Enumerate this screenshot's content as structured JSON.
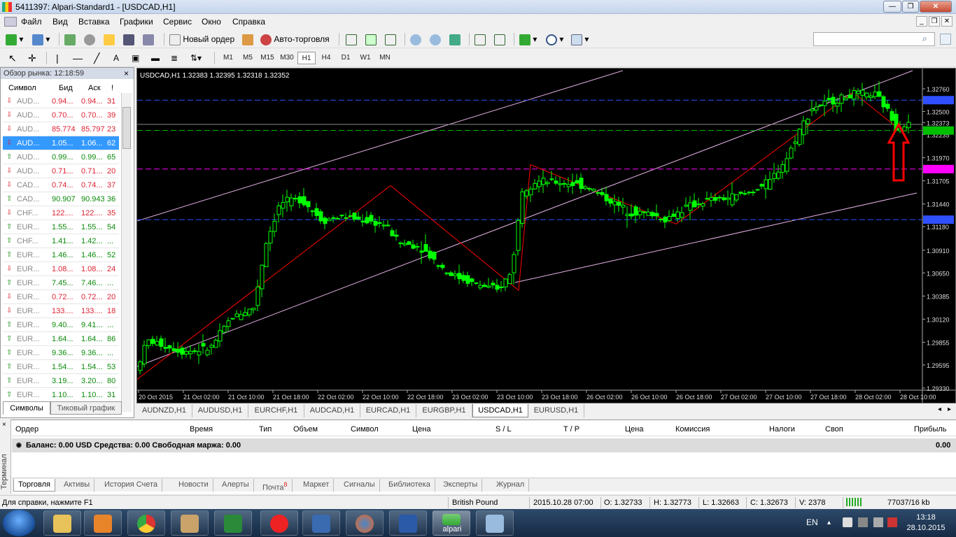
{
  "window": {
    "title": "5411397: Alpari-Standard1 - [USDCAD,H1]"
  },
  "menu": [
    "Файл",
    "Вид",
    "Вставка",
    "Графики",
    "Сервис",
    "Окно",
    "Справка"
  ],
  "toolbar": {
    "new_order": "Новый ордер",
    "auto_trading": "Авто-торговля"
  },
  "timeframes": [
    "M1",
    "M5",
    "M15",
    "M30",
    "H1",
    "H4",
    "D1",
    "W1",
    "MN"
  ],
  "selected_timeframe": "H1",
  "market_watch": {
    "title": "Обзор рынка: 12:18:59",
    "columns": [
      "Символ",
      "Бид",
      "Аск",
      "!"
    ],
    "rows": [
      {
        "symbol": "AUD...",
        "bid": "0.94...",
        "ask": "0.94...",
        "spread": "31",
        "dir": "down"
      },
      {
        "symbol": "AUD...",
        "bid": "0.70...",
        "ask": "0.70...",
        "spread": "39",
        "dir": "down"
      },
      {
        "symbol": "AUD...",
        "bid": "85.774",
        "ask": "85.797",
        "spread": "23",
        "dir": "down"
      },
      {
        "symbol": "AUD...",
        "bid": "1.05...",
        "ask": "1.06...",
        "spread": "62",
        "dir": "down",
        "selected": true
      },
      {
        "symbol": "AUD...",
        "bid": "0.99...",
        "ask": "0.99...",
        "spread": "65",
        "dir": "up"
      },
      {
        "symbol": "AUD...",
        "bid": "0.71...",
        "ask": "0.71...",
        "spread": "20",
        "dir": "down"
      },
      {
        "symbol": "CAD...",
        "bid": "0.74...",
        "ask": "0.74...",
        "spread": "37",
        "dir": "down"
      },
      {
        "symbol": "CAD...",
        "bid": "90.907",
        "ask": "90.943",
        "spread": "36",
        "dir": "up"
      },
      {
        "symbol": "CHF...",
        "bid": "122....",
        "ask": "122....",
        "spread": "35",
        "dir": "down"
      },
      {
        "symbol": "EUR...",
        "bid": "1.55...",
        "ask": "1.55...",
        "spread": "54",
        "dir": "up"
      },
      {
        "symbol": "CHF...",
        "bid": "1.41...",
        "ask": "1.42...",
        "spread": "...",
        "dir": "up"
      },
      {
        "symbol": "EUR...",
        "bid": "1.46...",
        "ask": "1.46...",
        "spread": "52",
        "dir": "up"
      },
      {
        "symbol": "EUR...",
        "bid": "1.08...",
        "ask": "1.08...",
        "spread": "24",
        "dir": "down"
      },
      {
        "symbol": "EUR...",
        "bid": "7.45...",
        "ask": "7.46...",
        "spread": "...",
        "dir": "up"
      },
      {
        "symbol": "EUR...",
        "bid": "0.72...",
        "ask": "0.72...",
        "spread": "20",
        "dir": "down"
      },
      {
        "symbol": "EUR...",
        "bid": "133....",
        "ask": "133....",
        "spread": "18",
        "dir": "down"
      },
      {
        "symbol": "EUR...",
        "bid": "9.40...",
        "ask": "9.41...",
        "spread": "...",
        "dir": "up"
      },
      {
        "symbol": "EUR...",
        "bid": "1.64...",
        "ask": "1.64...",
        "spread": "86",
        "dir": "up"
      },
      {
        "symbol": "EUR...",
        "bid": "9.36...",
        "ask": "9.36...",
        "spread": "...",
        "dir": "up"
      },
      {
        "symbol": "EUR...",
        "bid": "1.54...",
        "ask": "1.54...",
        "spread": "53",
        "dir": "up"
      },
      {
        "symbol": "EUR...",
        "bid": "3.19...",
        "ask": "3.20...",
        "spread": "80",
        "dir": "up"
      },
      {
        "symbol": "EUR...",
        "bid": "1.10...",
        "ask": "1.10...",
        "spread": "31",
        "dir": "up"
      }
    ],
    "tabs": [
      "Символы",
      "Тиковый график"
    ]
  },
  "chart": {
    "info": "USDCAD,H1  1.32383 1.32395 1.32318 1.32352",
    "price_labels": [
      "1.32760",
      "1.32500",
      "1.32373",
      "1.32235",
      "1.31970",
      "1.31705",
      "1.31440",
      "1.31180",
      "1.30910",
      "1.30650",
      "1.30385",
      "1.30120",
      "1.29855",
      "1.29595",
      "1.29330"
    ],
    "time_labels": [
      "20 Oct 2015",
      "21 Oct 02:00",
      "21 Oct 10:00",
      "21 Oct 18:00",
      "22 Oct 02:00",
      "22 Oct 10:00",
      "22 Oct 18:00",
      "23 Oct 02:00",
      "23 Oct 10:00",
      "23 Oct 18:00",
      "26 Oct 02:00",
      "26 Oct 10:00",
      "26 Oct 18:00",
      "27 Oct 02:00",
      "27 Oct 10:00",
      "27 Oct 18:00",
      "28 Oct 02:00",
      "28 Oct 10:00"
    ],
    "colors": {
      "bull": "#00ff00",
      "line": "#ff0000",
      "channel": "#e6b3e6",
      "hline_blue": "#3050ff",
      "hline_magenta": "#ff00ff",
      "hline_green": "#00c000"
    }
  },
  "chart_tabs": [
    "AUDNZD,H1",
    "AUDUSD,H1",
    "EURCHF,H1",
    "AUDCAD,H1",
    "EURCAD,H1",
    "EURGBP,H1",
    "USDCAD,H1",
    "EURUSD,H1"
  ],
  "active_chart_tab": "USDCAD,H1",
  "terminal": {
    "side_label": "Терминал",
    "columns": [
      "Ордер",
      "Время",
      "Тип",
      "Объем",
      "Символ",
      "Цена",
      "S / L",
      "T / P",
      "Цена",
      "Комиссия",
      "Налоги",
      "Своп",
      "Прибыль"
    ],
    "balance": "Баланс: 0.00 USD  Средства: 0.00  Свободная маржа: 0.00",
    "profit": "0.00",
    "tabs": [
      "Торговля",
      "Активы",
      "История Счета",
      "Новости",
      "Алерты",
      "Почта",
      "Маркет",
      "Сигналы",
      "Библиотека",
      "Эксперты",
      "Журнал"
    ],
    "mail_badge": "8"
  },
  "status": {
    "help": "Для справки, нажмите F1",
    "profile": "British Pound",
    "time": "2015.10.28 07:00",
    "open": "O: 1.32733",
    "high": "H: 1.32773",
    "low": "L: 1.32663",
    "close": "C: 1.32673",
    "volume": "V: 2378",
    "traffic": "77037/16 kb"
  },
  "taskbar": {
    "lang": "EN",
    "time": "13:18",
    "date": "28.10.2015",
    "alpari_label": "alpari"
  }
}
